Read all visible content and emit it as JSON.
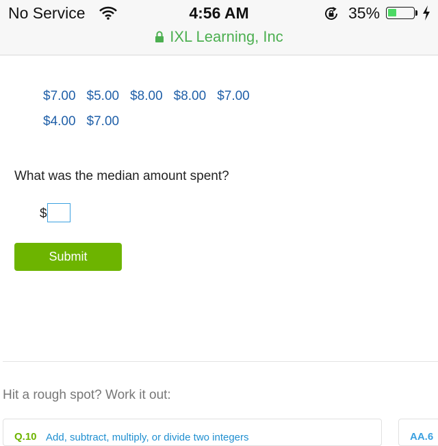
{
  "status_bar": {
    "carrier": "No Service",
    "time": "4:56 AM",
    "battery_percent": "35%",
    "battery_level": 0.35,
    "icons": [
      "wifi-icon",
      "orientation-lock-icon",
      "battery-icon",
      "charging-bolt-icon"
    ]
  },
  "browser": {
    "site_name": "IXL Learning, Inc",
    "secure": true,
    "accent_color": "#4caf50"
  },
  "question": {
    "amounts": [
      "$7.00",
      "$5.00",
      "$8.00",
      "$8.00",
      "$7.00",
      "$4.00",
      "$7.00"
    ],
    "prompt": "What was the median amount spent?",
    "currency_symbol": "$",
    "answer_value": "",
    "submit_label": "Submit",
    "submit_color": "#6db400"
  },
  "help": {
    "heading": "Hit a rough spot? Work it out:",
    "skills": [
      {
        "code": "Q.10",
        "title": "Add, subtract, multiply, or divide two integers"
      },
      {
        "code": "AA.6",
        "title": ""
      }
    ]
  }
}
